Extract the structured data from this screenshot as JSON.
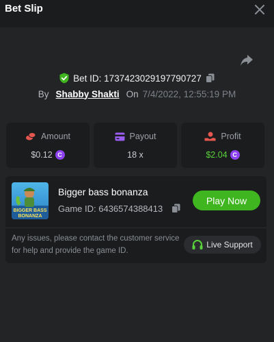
{
  "header": {
    "title": "Bet Slip"
  },
  "bet": {
    "id_text": "Bet ID: 1737423029197790727",
    "by_label": "By",
    "user": "Shabby Shakti",
    "on_label": "On",
    "date": "7/4/2022, 12:55:19 PM"
  },
  "stats": {
    "amount": {
      "label": "Amount",
      "value": "$0.12"
    },
    "payout": {
      "label": "Payout",
      "value": "18 x"
    },
    "profit": {
      "label": "Profit",
      "value": "$2.04"
    }
  },
  "game": {
    "name": "Bigger bass bonanza",
    "id_text": "Game ID: 6436574388413",
    "thumb_text": "BIGGER BASS BONANZA",
    "play_label": "Play Now"
  },
  "support": {
    "message": "Any issues, please contact the customer service for help and provide the game ID.",
    "button_label": "Live Support"
  },
  "icons": {
    "close": "close-icon",
    "share": "share-icon",
    "verified": "shield-check-icon",
    "copy": "copy-icon",
    "amount": "coins-icon",
    "payout": "card-icon",
    "profit": "hand-coin-icon",
    "coin": "currency-c-icon",
    "support": "headset-icon"
  },
  "colors": {
    "accent_green": "#3fb61f",
    "profit_green": "#58d23a",
    "coin_purple": "#8d42f0",
    "panel": "#1b1c1e",
    "background": "#232426"
  }
}
